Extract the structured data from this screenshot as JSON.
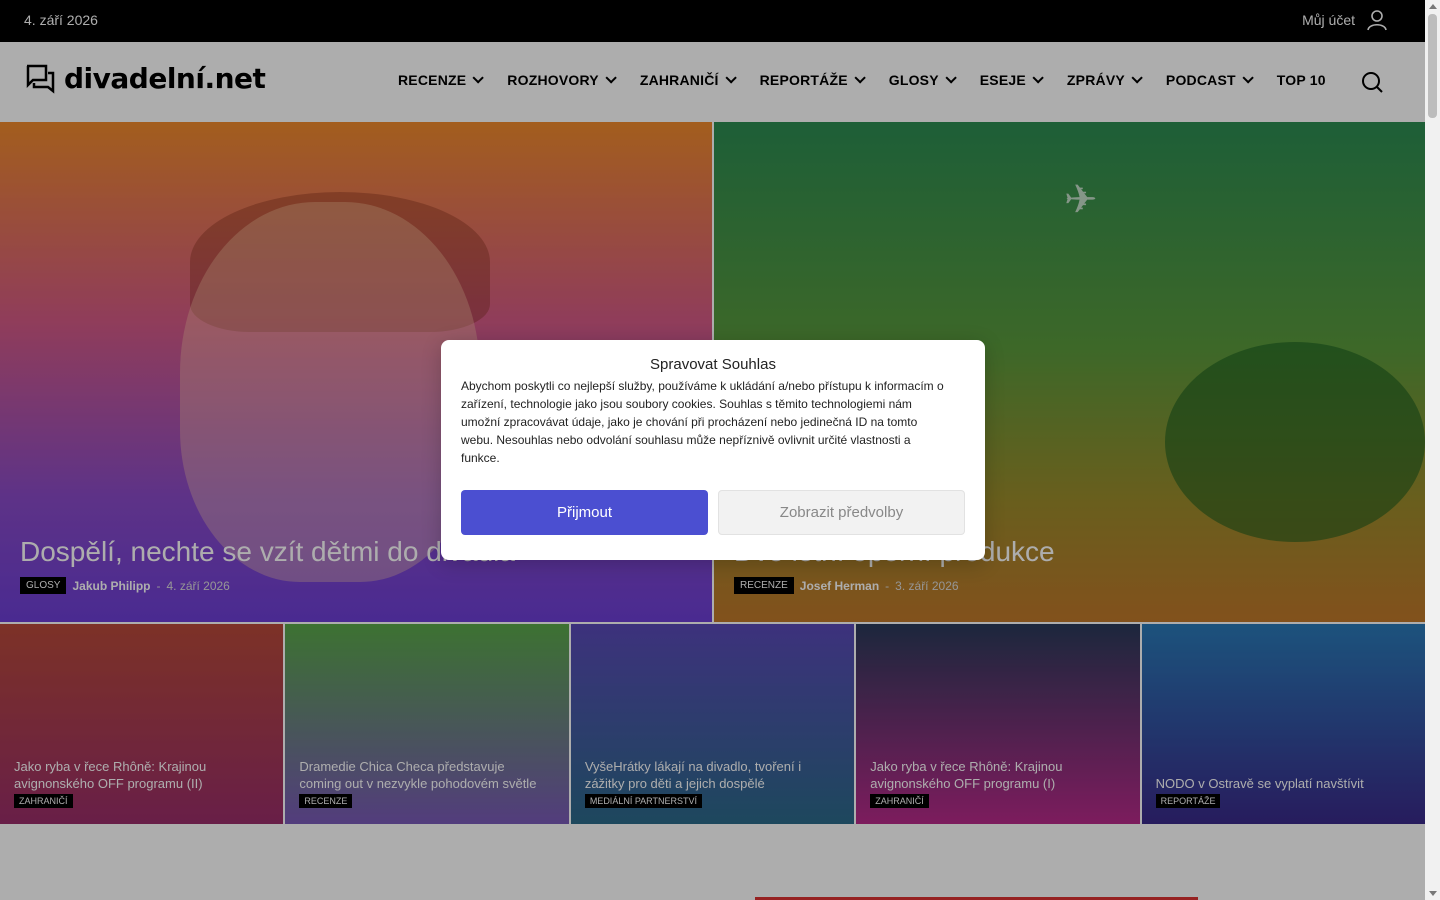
{
  "topbar": {
    "date": "4. září 2026",
    "account_label": "Můj účet"
  },
  "logo": {
    "text": "divadelní.net"
  },
  "nav": [
    {
      "label": "RECENZE",
      "has_dropdown": true
    },
    {
      "label": "ROZHOVORY",
      "has_dropdown": true
    },
    {
      "label": "ZAHRANIČÍ",
      "has_dropdown": true
    },
    {
      "label": "REPORTÁŽE",
      "has_dropdown": true
    },
    {
      "label": "GLOSY",
      "has_dropdown": true
    },
    {
      "label": "ESEJE",
      "has_dropdown": true
    },
    {
      "label": "ZPRÁVY",
      "has_dropdown": true
    },
    {
      "label": "PODCAST",
      "has_dropdown": true
    },
    {
      "label": "TOP 10",
      "has_dropdown": false
    }
  ],
  "hero": [
    {
      "title": "Dospělí, nechte se vzít dětmi do divadla",
      "category": "GLOSY",
      "author": "Jakub Philipp",
      "date": "4. září 2026"
    },
    {
      "title": "Dvě letní operní produkce",
      "category": "RECENZE",
      "author": "Josef Herman",
      "date": "3. září 2026"
    }
  ],
  "tiles": [
    {
      "title": "Jako ryba v řece Rhôně: Krajinou avignonského OFF programu (II)",
      "category": "ZAHRANIČÍ"
    },
    {
      "title": "Dramedie Chica Checa představuje coming out v nezvykle pohodovém světle",
      "category": "RECENZE"
    },
    {
      "title": "VyšeHrátky lákají na divadlo, tvoření i zážitky pro děti a jejich dospělé",
      "category": "MEDIÁLNÍ PARTNERSTVÍ"
    },
    {
      "title": "Jako ryba v řece Rhôně: Krajinou avignonského OFF programu (I)",
      "category": "ZAHRANIČÍ"
    },
    {
      "title": "NODO v Ostravě se vyplatí navštívit",
      "category": "REPORTÁŽE"
    }
  ],
  "cookie": {
    "title": "Spravovat Souhlas",
    "text": "Abychom poskytli co nejlepší služby, používáme k ukládání a/nebo přístupu k informacím o zařízení, technologie jako jsou soubory cookies. Souhlas s těmito technologiemi nám umožní zpracovávat údaje, jako je chování při procházení nebo jedinečná ID na tomto webu. Nesouhlas nebo odvolání souhlasu může nepříznivě ovlivnit určité vlastnosti a funkce.",
    "accept_label": "Přijmout",
    "prefs_label": "Zobrazit předvolby"
  },
  "colors": {
    "accent": "#4b4fd1",
    "topbar": "#000000"
  }
}
